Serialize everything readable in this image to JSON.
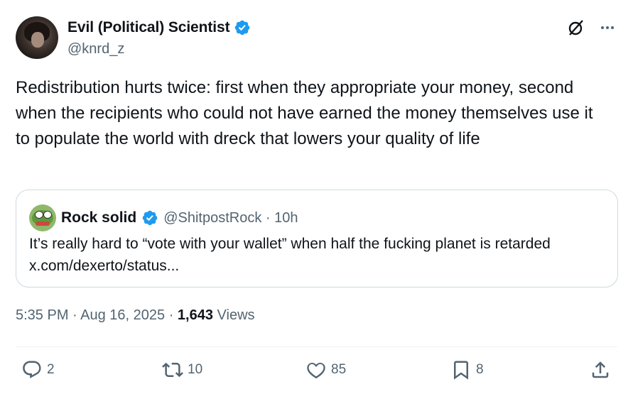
{
  "author": {
    "display_name": "Evil (Political) Scientist",
    "handle": "@knrd_z"
  },
  "post": {
    "text": "Redistribution hurts twice: first when they appropriate your money, second when the recipients who could not have earned the money themselves use it to populate the world with dreck that lowers your quality of life"
  },
  "quoted_post": {
    "display_name": "Rock solid",
    "handle_time": "@ShitpostRock · 10h",
    "text": "It’s really hard to “vote with your wallet” when half the fucking planet is retarded x.com/dexerto/status..."
  },
  "meta": {
    "timestamp": "5:35 PM · Aug 16, 2025 · ",
    "views_count": "1,643",
    "views_label": " Views"
  },
  "actions": {
    "replies": "2",
    "reposts": "10",
    "likes": "85",
    "bookmarks": "8"
  },
  "colors": {
    "verified_blue": "#1d9bf0",
    "secondary_text": "#536471",
    "border": "#cfd9de"
  },
  "icons": [
    "verified-icon",
    "grok-icon",
    "more-icon",
    "reply-icon",
    "repost-icon",
    "like-icon",
    "bookmark-icon",
    "share-icon"
  ]
}
